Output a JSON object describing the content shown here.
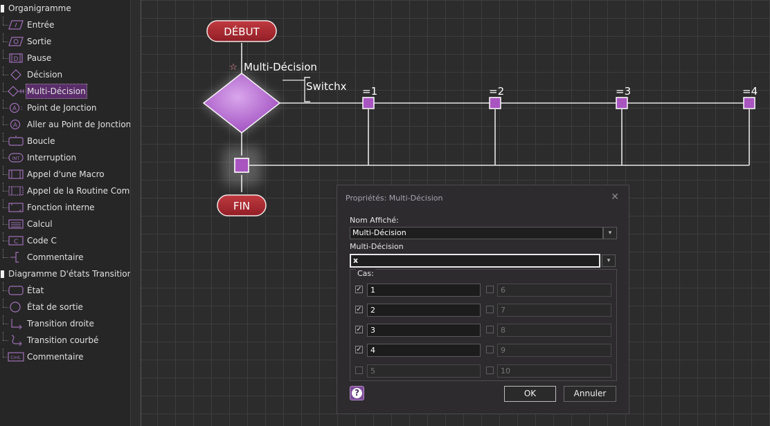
{
  "sidebar": {
    "groups": [
      {
        "label": "Organigramme",
        "items": [
          {
            "label": "Entrée",
            "icon": "input-icon"
          },
          {
            "label": "Sortie",
            "icon": "output-icon"
          },
          {
            "label": "Pause",
            "icon": "pause-icon"
          },
          {
            "label": "Décision",
            "icon": "decision-diamond-icon"
          },
          {
            "label": "Multi-Décision",
            "icon": "multi-decision-icon",
            "selected": true
          },
          {
            "label": "Point de Jonction",
            "icon": "junction-point-icon"
          },
          {
            "label": "Aller au Point de Jonction",
            "icon": "goto-junction-icon"
          },
          {
            "label": "Boucle",
            "icon": "loop-icon"
          },
          {
            "label": "Interruption",
            "icon": "interrupt-icon"
          },
          {
            "label": "Appel d'une Macro",
            "icon": "macro-call-icon"
          },
          {
            "label": "Appel de la Routine Compo",
            "icon": "routine-call-icon"
          },
          {
            "label": "Fonction interne",
            "icon": "internal-function-icon"
          },
          {
            "label": "Calcul",
            "icon": "calculation-icon"
          },
          {
            "label": "Code C",
            "icon": "c-code-icon"
          },
          {
            "label": "Commentaire",
            "icon": "comment-bracket-icon"
          }
        ]
      },
      {
        "label": "Diagramme D'états Transitions",
        "items": [
          {
            "label": "État",
            "icon": "state-icon"
          },
          {
            "label": "État de sortie",
            "icon": "exit-state-icon"
          },
          {
            "label": "Transition droite",
            "icon": "straight-transition-icon"
          },
          {
            "label": "Transition courbé",
            "icon": "curved-transition-icon"
          },
          {
            "label": "Commentaire",
            "icon": "comment-cmt-icon"
          }
        ]
      }
    ]
  },
  "flowchart": {
    "start_label": "DÉBUT",
    "end_label": "FIN",
    "decision_label": "Multi-Décision",
    "switch_label": "Switchx",
    "case_labels": [
      "=1",
      "=2",
      "=3",
      "=4"
    ],
    "colors": {
      "accent": "#a855c0",
      "pill": "#a8282e"
    }
  },
  "dialog": {
    "title": "Propriétés: Multi-Décision",
    "name_label": "Nom Affiché:",
    "name_value": "Multi-Décision",
    "expr_label": "Multi-Décision",
    "expr_value": "x",
    "cases_label": "Cas:",
    "cases": [
      {
        "value": "1",
        "checked": true,
        "enabled": true
      },
      {
        "value": "2",
        "checked": true,
        "enabled": true
      },
      {
        "value": "3",
        "checked": true,
        "enabled": true
      },
      {
        "value": "4",
        "checked": true,
        "enabled": true
      },
      {
        "value": "5",
        "checked": false,
        "enabled": false
      },
      {
        "value": "6",
        "checked": false,
        "enabled": false
      },
      {
        "value": "7",
        "checked": false,
        "enabled": false
      },
      {
        "value": "8",
        "checked": false,
        "enabled": false
      },
      {
        "value": "9",
        "checked": false,
        "enabled": false
      },
      {
        "value": "10",
        "checked": false,
        "enabled": false
      }
    ],
    "ok_label": "OK",
    "cancel_label": "Annuler"
  }
}
